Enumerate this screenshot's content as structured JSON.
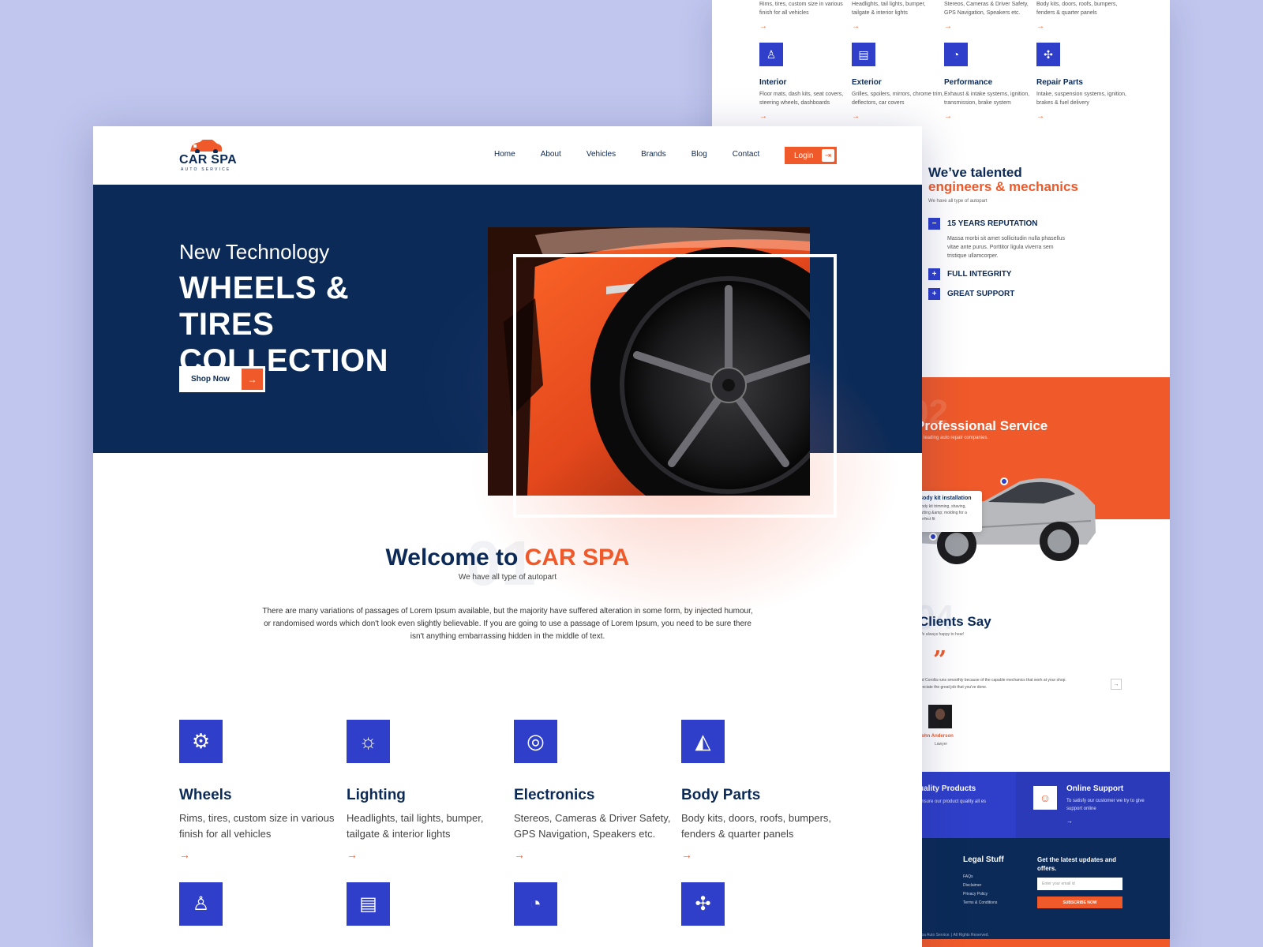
{
  "back": {
    "top_row": [
      {
        "desc": "Rims, tires, custom size in various finish for all vehicles"
      },
      {
        "desc": "Headlights, tail lights, bumper, tailgate & interior lights"
      },
      {
        "desc": "Stereos, Cameras & Driver Safety, GPS Navigation, Speakers etc."
      },
      {
        "desc": "Body kits, doors, roofs, bumpers, fenders & quarter panels"
      }
    ],
    "second_row": [
      {
        "title": "Interior",
        "desc": "Floor mats, dash kits, seat covers, steering wheels, dashboards",
        "icon": "bottle-icon"
      },
      {
        "title": "Exterior",
        "desc": "Grilles, spoilers, mirrors, chrome trim, deflectors, car covers",
        "icon": "car-door-icon"
      },
      {
        "title": "Performance",
        "desc": "Exhaust & intake systems, ignition, transmission, brake system",
        "icon": "gauge-icon"
      },
      {
        "title": "Repair Parts",
        "desc": "Intake, suspension systems, ignition, brakes & fuel delivery",
        "icon": "engine-icon"
      }
    ],
    "talent": {
      "line1": "We’ve talented",
      "line2": "engineers & mechanics",
      "sub": "We have all type of autopart",
      "items": [
        {
          "label": "15 YEARS REPUTATION",
          "toggle": "−",
          "text": "Massa morbi sit amet sollicitudin nulla phasellus vitae ante purus. Porttitor ligula viverra sem tristique ullamcorper."
        },
        {
          "label": "FULL INTEGRITY",
          "toggle": "+"
        },
        {
          "label": "GREAT SUPPORT",
          "toggle": "+"
        }
      ]
    },
    "service": {
      "number": "02",
      "title": "Professional Service",
      "sub": "the leading auto repair companies.",
      "tooltip_title": "Body kit installation",
      "tooltip_text": "Body kit trimming, shaving, cutting &amp; molding for a perfect fit"
    },
    "clients": {
      "number": "04",
      "title": "Clients Say",
      "sub": "We always happy to hear!",
      "quote_mark": "”",
      "quote": "old Corolla runs smoothly because of the capable mechanics that work at your shop. preciate the great job that you've done.",
      "next": "→",
      "name": "John Anderson",
      "role": "Lawyer"
    },
    "features": {
      "left_title": "uality Products",
      "left_desc": "ensure our product quality all es",
      "right_title": "Online Support",
      "right_desc": "To satisfy our customer we try to give support online",
      "right_icon": "support-agent-icon",
      "arrow": "→"
    },
    "footer": {
      "legal_title": "Legal Stuff",
      "legal_links": [
        "FAQs",
        "Disclaimer",
        "Privacy Policy",
        "Terms & Conditions"
      ],
      "newsletter_title": "Get the latest updates and offers.",
      "email_placeholder": "Enter your email id",
      "subscribe": "SUBSCRIBE NOW",
      "copyright": "Spa Auto Service. | All Rights Reserved.",
      "stub": "ct"
    }
  },
  "nav": {
    "brand": "CAR SPA",
    "tagline": "AUTO SERVICE",
    "links": [
      "Home",
      "About",
      "Vehicles",
      "Brands",
      "Blog",
      "Contact"
    ],
    "login": "Login",
    "login_icon": "sign-in-icon"
  },
  "hero": {
    "kicker": "New Technology",
    "title": "WHEELS & TIRES\nCOLLECTION",
    "cta": "Shop Now",
    "cta_arrow": "→"
  },
  "welcome": {
    "number": "01",
    "title_pre": "Welcome to ",
    "title_accent": "CAR SPA",
    "sub": "We have all type of autopart",
    "paragraph": "There are many variations of passages of Lorem Ipsum available, but the majority have suffered alteration in some form, by injected humour, or randomised words which don't look even slightly believable. If you are going to use a passage of Lorem Ipsum, you need to be sure there isn't anything embarrassing hidden in the middle of text."
  },
  "categories": [
    {
      "title": "Wheels",
      "desc": "Rims, tires, custom size in various finish for all vehicles",
      "icon": "wheel-icon",
      "arrow": "→"
    },
    {
      "title": "Lighting",
      "desc": "Headlights, tail lights, bumper, tailgate & interior lights",
      "icon": "light-bulb-icon",
      "arrow": "→"
    },
    {
      "title": "Electronics",
      "desc": "Stereos, Cameras & Driver Safety, GPS Navigation, Speakers etc.",
      "icon": "electronics-icon",
      "arrow": "→"
    },
    {
      "title": "Body Parts",
      "desc": "Body kits, doors, roofs, bumpers, fenders & quarter panels",
      "icon": "car-body-icon",
      "arrow": "→"
    }
  ],
  "colors": {
    "navy": "#0b2a57",
    "orange": "#f05a2a",
    "blue": "#2f3fc9",
    "background": "#c0c6ee"
  }
}
